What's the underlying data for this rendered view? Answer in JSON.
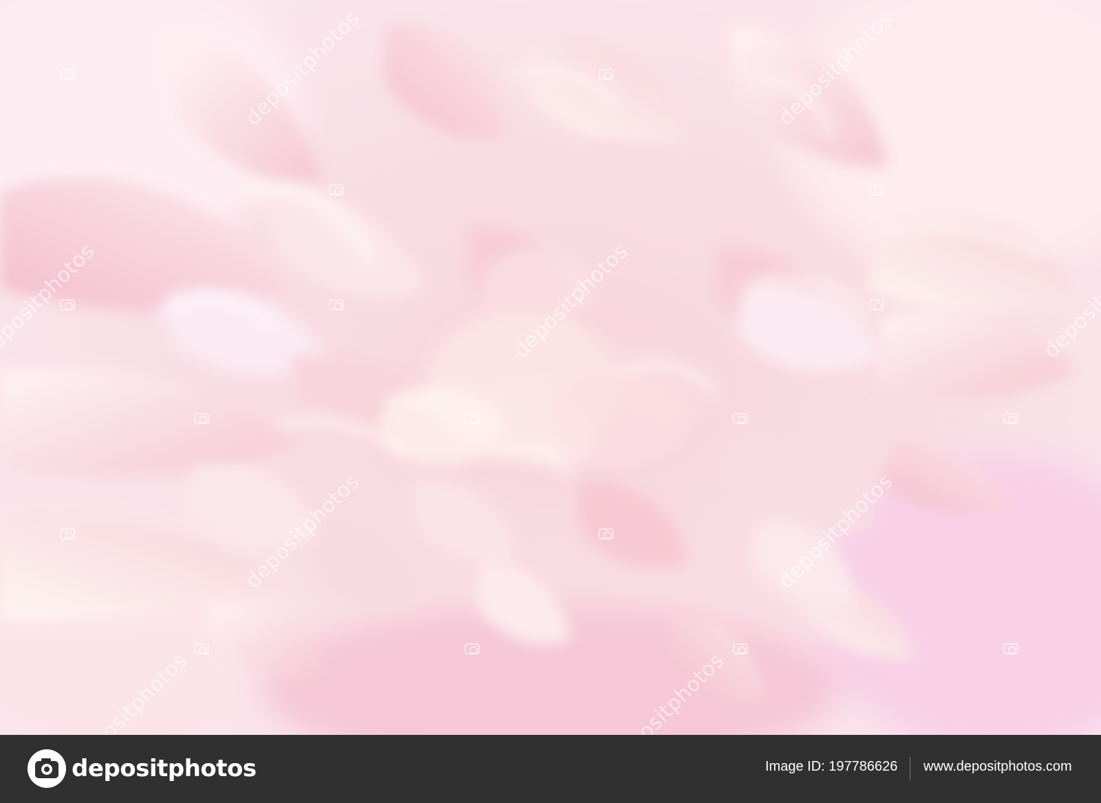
{
  "photo": {
    "subject": "pink peony flower",
    "watermark_text": "depositphotos",
    "colors": {
      "base": "#f7d3dc",
      "petal_light": "#fde8ee",
      "petal_mid": "#f6c2cf",
      "petal_deep": "#efb0c2",
      "highlight": "#fff4f2",
      "lilac": "#f6cde8"
    }
  },
  "footer": {
    "brand": "depositphotos",
    "image_id_label": "Image ID:",
    "image_id": "197786626",
    "image_id_text": "Image ID: 197786626",
    "site_url": "www.depositphotos.com",
    "background_color": "#303030"
  }
}
